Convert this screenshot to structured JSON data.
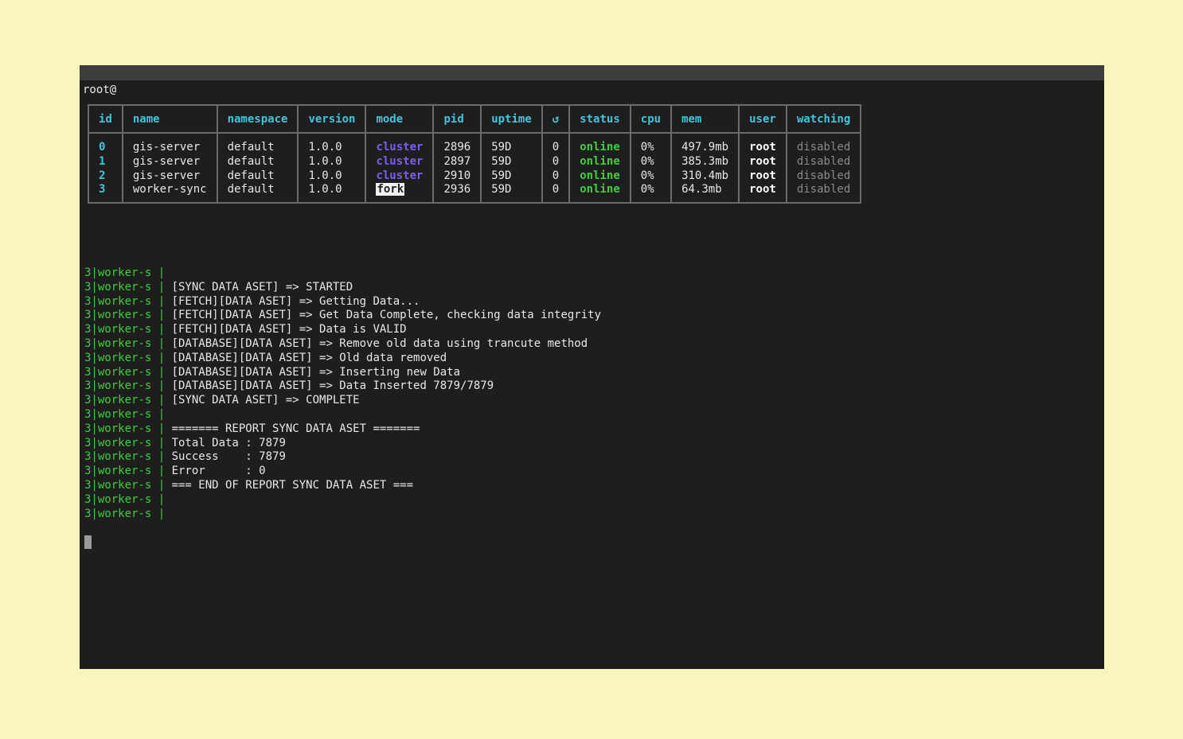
{
  "prompt": "root@",
  "table": {
    "headers": [
      "id",
      "name",
      "namespace",
      "version",
      "mode",
      "pid",
      "uptime",
      "↺",
      "status",
      "cpu",
      "mem",
      "user",
      "watching"
    ],
    "rows": [
      {
        "id": "0",
        "name": "gis-server",
        "namespace": "default",
        "version": "1.0.0",
        "mode": "cluster",
        "pid": "2896",
        "uptime": "59D",
        "restarts": "0",
        "status": "online",
        "cpu": "0%",
        "mem": "497.9mb",
        "user": "root",
        "watching": "disabled"
      },
      {
        "id": "1",
        "name": "gis-server",
        "namespace": "default",
        "version": "1.0.0",
        "mode": "cluster",
        "pid": "2897",
        "uptime": "59D",
        "restarts": "0",
        "status": "online",
        "cpu": "0%",
        "mem": "385.3mb",
        "user": "root",
        "watching": "disabled"
      },
      {
        "id": "2",
        "name": "gis-server",
        "namespace": "default",
        "version": "1.0.0",
        "mode": "cluster",
        "pid": "2910",
        "uptime": "59D",
        "restarts": "0",
        "status": "online",
        "cpu": "0%",
        "mem": "310.4mb",
        "user": "root",
        "watching": "disabled"
      },
      {
        "id": "3",
        "name": "worker-sync",
        "namespace": "default",
        "version": "1.0.0",
        "mode": "fork",
        "pid": "2936",
        "uptime": "59D",
        "restarts": "0",
        "status": "online",
        "cpu": "0%",
        "mem": "64.3mb",
        "user": "root",
        "watching": "disabled"
      }
    ]
  },
  "logs": {
    "prefix": "3|worker-s | ",
    "lines": [
      "",
      "[SYNC DATA ASET] => STARTED",
      "[FETCH][DATA ASET] => Getting Data...",
      "[FETCH][DATA ASET] => Get Data Complete, checking data integrity",
      "[FETCH][DATA ASET] => Data is VALID",
      "[DATABASE][DATA ASET] => Remove old data using trancute method",
      "[DATABASE][DATA ASET] => Old data removed",
      "[DATABASE][DATA ASET] => Inserting new Data",
      "[DATABASE][DATA ASET] => Data Inserted 7879/7879",
      "[SYNC DATA ASET] => COMPLETE",
      "",
      "======= REPORT SYNC DATA ASET =======",
      "Total Data : 7879",
      "Success    : 7879",
      "Error      : 0",
      "=== END OF REPORT SYNC DATA ASET ===",
      "",
      ""
    ]
  },
  "colors": {
    "background": "#f8f6bd",
    "terminal": "#1e1e1e",
    "header": "#3fc6de",
    "cluster": "#7d5cf2",
    "online": "#3ad13a",
    "disabled": "#8a8a8a"
  }
}
